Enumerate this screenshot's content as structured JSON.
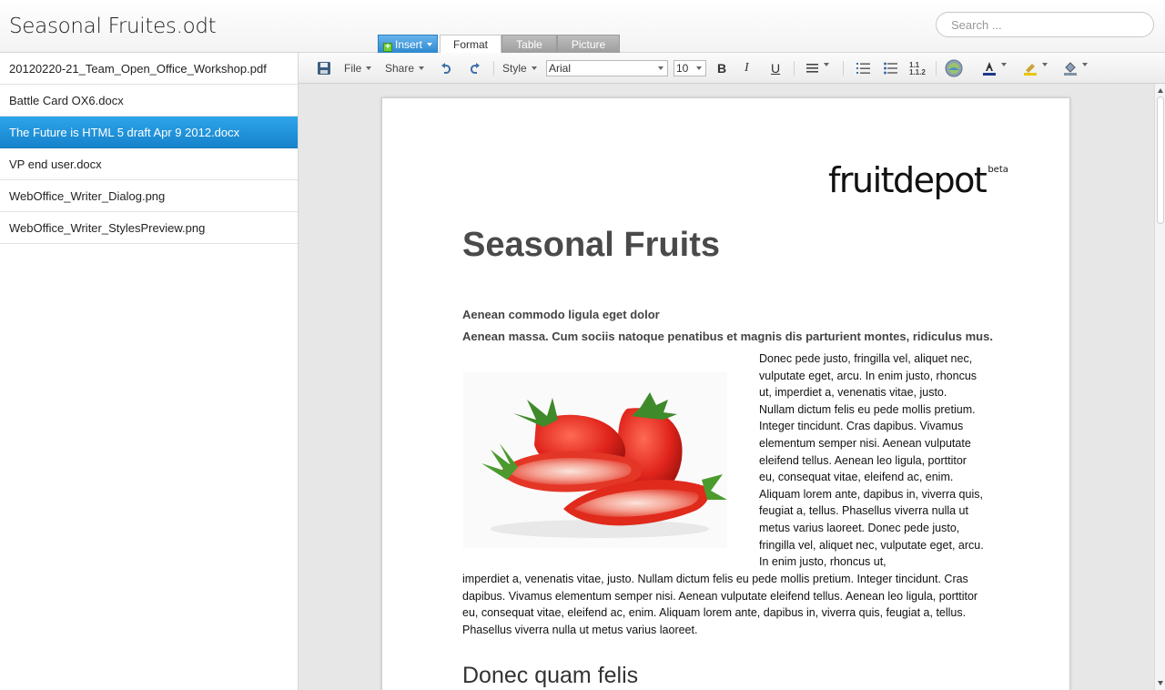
{
  "header": {
    "title": "Seasonal Fruites.odt",
    "search_placeholder": "Search ..."
  },
  "tabs": {
    "insert": "Insert",
    "format": "Format",
    "table": "Table",
    "picture": "Picture"
  },
  "sidebar": {
    "files": [
      {
        "name": "20120220-21_Team_Open_Office_Workshop.pdf",
        "selected": false
      },
      {
        "name": "Battle Card OX6.docx",
        "selected": false
      },
      {
        "name": "The Future is HTML 5 draft Apr 9 2012.docx",
        "selected": true
      },
      {
        "name": "VP end user.docx",
        "selected": false
      },
      {
        "name": "WebOffice_Writer_Dialog.png",
        "selected": false
      },
      {
        "name": "WebOffice_Writer_StylesPreview.png",
        "selected": false
      }
    ]
  },
  "toolbar": {
    "file_label": "File",
    "share_label": "Share",
    "style_label": "Style",
    "font_name": "Arial",
    "font_size": "10",
    "bold": "B",
    "italic": "I",
    "underline": "U",
    "numbered_list_label": "1.1\n1.1.2"
  },
  "document": {
    "logo": "fruitdepot",
    "logo_sup": "beta",
    "heading": "Seasonal Fruits",
    "subheading1": "Aenean commodo ligula eget dolor",
    "subheading2": "Aenean massa. Cum sociis natoque penatibus et magnis dis parturient montes, ridiculus mus.",
    "column_text": "Donec pede justo, fringilla vel, aliquet nec, vulputate eget, arcu. In enim justo, rhoncus ut, imperdiet a, venenatis vitae, justo. Nullam dictum felis eu pede mollis pretium. Integer tincidunt. Cras dapibus. Vivamus elementum semper nisi. Aenean vulputate eleifend tellus. Aenean leo ligula, porttitor eu, consequat vitae, eleifend ac, enim. Aliquam lorem ante, dapibus in, viverra quis, feugiat a, tellus. Phasellus viverra nulla ut metus varius laoreet. Donec pede justo, fringilla vel, aliquet nec, vulputate eget, arcu. In enim justo, rhoncus ut,",
    "full_text": "imperdiet a, venenatis vitae, justo. Nullam dictum felis eu pede mollis pretium. Integer tincidunt. Cras dapibus. Vivamus elementum semper nisi. Aenean vulputate eleifend tellus. Aenean leo ligula, porttitor eu, consequat vitae, eleifend ac, enim. Aliquam lorem ante, dapibus in, viverra quis, feugiat a, tellus. Phasellus viverra nulla ut metus varius laoreet.",
    "heading2": "Donec quam felis"
  },
  "colors": {
    "accent": "#1f8fd8",
    "selected_file_bg": "#1683cb",
    "canvas_bg": "#e7e7e7"
  }
}
